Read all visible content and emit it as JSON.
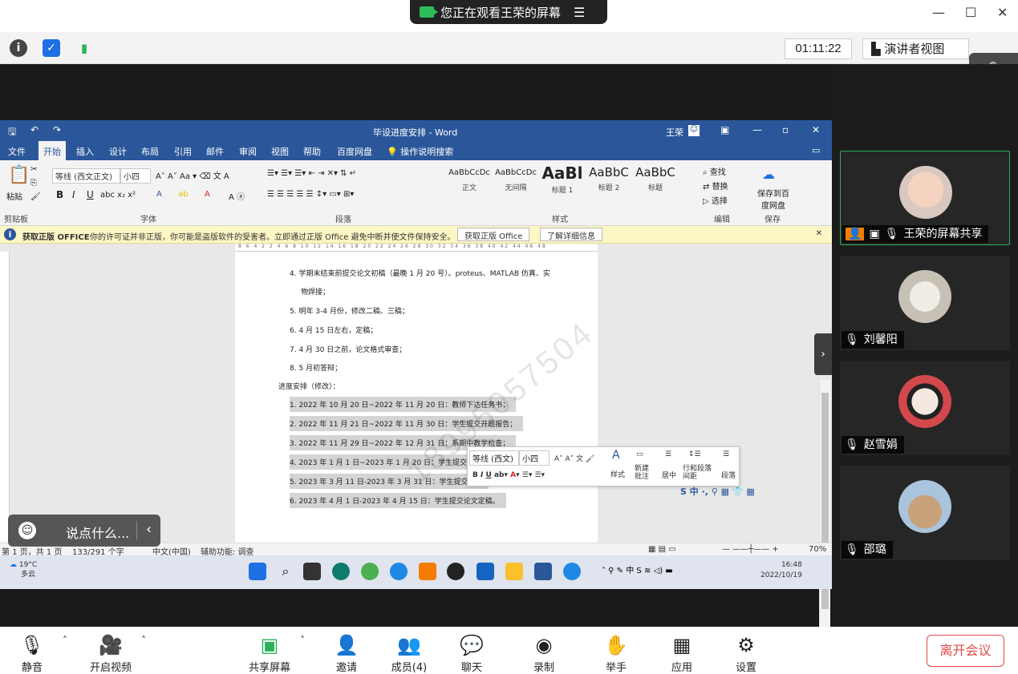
{
  "top": {
    "viewing_text": "您正在观看王荣的屏幕",
    "timer": "01:11:22",
    "speaker_view": "演讲者视图"
  },
  "word": {
    "title": "毕设进度安排 - Word",
    "user": "王荣",
    "tabs": [
      "文件",
      "开始",
      "插入",
      "设计",
      "布局",
      "引用",
      "邮件",
      "审阅",
      "视图",
      "帮助",
      "百度网盘",
      "操作说明搜索"
    ],
    "font_name": "等线 (西文正文)",
    "font_size": "小四",
    "paste_label": "粘贴",
    "group_labels": [
      "剪贴板",
      "字体",
      "段落",
      "样式",
      "编辑",
      "保存"
    ],
    "styles": [
      {
        "sample": "AaBbCcDc",
        "name": "正文"
      },
      {
        "sample": "AaBbCcDc",
        "name": "无间隔"
      },
      {
        "sample": "AaBl",
        "name": "标题 1"
      },
      {
        "sample": "AaBbC",
        "name": "标题 2"
      },
      {
        "sample": "AaBbC",
        "name": "标题"
      }
    ],
    "edit": {
      "find": "查找",
      "replace": "替换",
      "select": "选择"
    },
    "save_to": "保存到百度网盘",
    "warning": {
      "bold": "获取正版 OFFICE",
      "message": "你的许可证并非正版，你可能是盗版软件的受害者。立即通过正版 Office 避免中断并使文件保持安全。",
      "btn_get": "获取正版 Office",
      "btn_more": "了解详细信息"
    },
    "ruler": "8 6 4 2 2 4 6 8 10 12 14 16 18 20 22 24 26 28 30 32 34 36 38 40 42 44 46 48",
    "lines": [
      "4. 学期末结束前提交论文初稿（最晚 1 月 20 号）。proteus、MATLAB 仿真、实",
      "物焊接；",
      "5. 明年 3-4 月份，修改二稿、三稿；",
      "6. 4 月 15 日左右，定稿；",
      "7. 4 月 30 日之前，论文格式审查；",
      "8. 5 月初答辩；",
      "进度安排（修改）：",
      "1. 2022 年 10 月 20 日~2022 年 11 月 20 日：教师下达任务书；",
      "2. 2022 年 11 月 21 日~2022 年 11 月 30 日：学生提交开题报告；",
      "3. 2022 年 11 月 29 日~2022 年 12 月 31 日：系期中教学检查；",
      "4. 2023 年 1 月 1 日~2023 年 1 月 20 日：学生提交论文",
      "5. 2023 年 3 月 11 日-2023 年 3 月 31 日：学生提交论文",
      "6. 2023 年 4 月 1 日-2023 年 4 月 15 日：学生提交论文定稿。"
    ],
    "watermark": "18995057504",
    "mini": {
      "font": "等线 (西文)",
      "size": "小四",
      "style": "样式",
      "new_comment": "新建批注",
      "center": "居中",
      "line_spacing": "行和段落间距",
      "paragraph": "段落"
    },
    "status": {
      "page": "第 1 页，共 1 页",
      "words": "133/291 个字",
      "lang": "中文(中国)",
      "access": "辅助功能: 调查",
      "zoom": "70%"
    },
    "taskbar": {
      "temp": "19°C",
      "weather": "多云",
      "time": "16:48",
      "date": "2022/10/19"
    }
  },
  "chat_placeholder": "说点什么...",
  "participants": [
    {
      "name": "王荣的屏幕共享",
      "active": true
    },
    {
      "name": "刘馨阳",
      "active": false
    },
    {
      "name": "赵雪娟",
      "active": false
    },
    {
      "name": "邵璐",
      "active": false
    }
  ],
  "bottom": {
    "mute": "静音",
    "video": "开启视频",
    "share": "共享屏幕",
    "invite": "邀请",
    "members": "成员(4)",
    "chat": "聊天",
    "record": "录制",
    "raise": "举手",
    "apps": "应用",
    "settings": "设置",
    "leave": "离开会议"
  },
  "colors": {
    "word_blue": "#2b579a",
    "leave_red": "#e04848",
    "active_green": "#2bb15a"
  }
}
